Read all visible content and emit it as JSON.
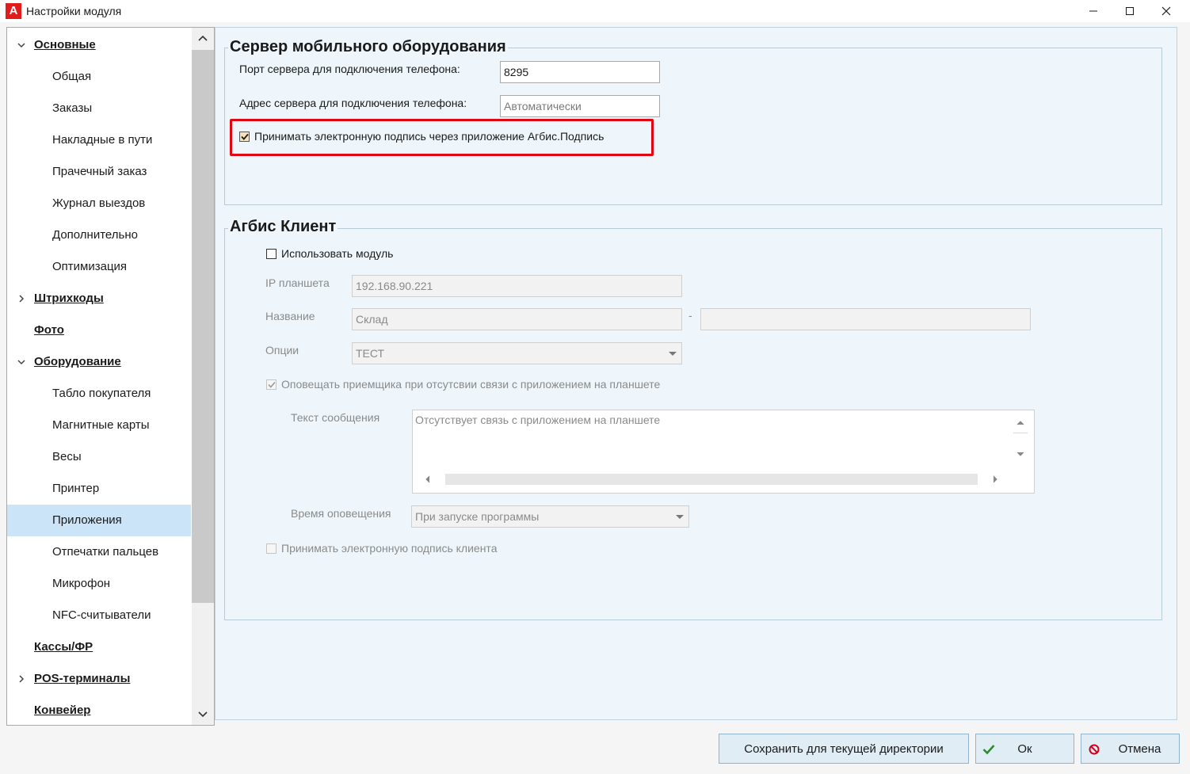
{
  "window": {
    "title": "Настройки модуля",
    "logo_letter": "A"
  },
  "tree": {
    "items": [
      {
        "label": "Основные",
        "level": 0,
        "expander": "expanded"
      },
      {
        "label": "Общая",
        "level": 1
      },
      {
        "label": "Заказы",
        "level": 1
      },
      {
        "label": "Накладные в пути",
        "level": 1
      },
      {
        "label": "Прачечный заказ",
        "level": 1
      },
      {
        "label": "Журнал выездов",
        "level": 1
      },
      {
        "label": "Дополнительно",
        "level": 1
      },
      {
        "label": "Оптимизация",
        "level": 1
      },
      {
        "label": "Штрихкоды",
        "level": 0,
        "expander": "collapsed"
      },
      {
        "label": "Фото",
        "level": 0,
        "expander": "none"
      },
      {
        "label": "Оборудование",
        "level": 0,
        "expander": "expanded"
      },
      {
        "label": "Табло покупателя",
        "level": 1
      },
      {
        "label": "Магнитные карты",
        "level": 1
      },
      {
        "label": "Весы",
        "level": 1
      },
      {
        "label": "Принтер",
        "level": 1
      },
      {
        "label": "Приложения",
        "level": 1,
        "selected": true
      },
      {
        "label": "Отпечатки пальцев",
        "level": 1
      },
      {
        "label": "Микрофон",
        "level": 1
      },
      {
        "label": "NFC-считыватели",
        "level": 1
      },
      {
        "label": "Кассы/ФР",
        "level": 0,
        "expander": "none"
      },
      {
        "label": "POS-терминалы",
        "level": 0,
        "expander": "collapsed"
      },
      {
        "label": "Конвейер",
        "level": 0,
        "expander": "none"
      }
    ]
  },
  "mobile_server": {
    "title": "Сервер мобильного оборудования",
    "port_label": "Порт сервера для подключения телефона:",
    "port_value": "8295",
    "address_label": "Адрес сервера для подключения телефона:",
    "address_placeholder": "Автоматически",
    "accept_signature_label": "Принимать электронную подпись через приложение Агбис.Подпись",
    "accept_signature_checked": true
  },
  "agbis_client": {
    "title": "Агбис Клиент",
    "use_module_label": "Использовать модуль",
    "use_module_checked": false,
    "ip_label": "IP планшета",
    "ip_value": "192.168.90.221",
    "name_label": "Название",
    "name_value": "Склад",
    "name_separator": "-",
    "name_value_2": "",
    "options_label": "Опции",
    "options_value": "ТЕСТ",
    "notify_label": "Оповещать приемщика при отсутсвии связи с приложением на планшете",
    "notify_checked": true,
    "message_label": "Текст сообщения",
    "message_value": "Отсутствует связь с приложением на планшете",
    "notify_time_label": "Время оповещения",
    "notify_time_value": "При запуске программы",
    "accept_client_signature_label": "Принимать электронную подпись клиента",
    "accept_client_signature_checked": false
  },
  "buttons": {
    "save_dir": "Сохранить для текущей директории",
    "ok": "Ок",
    "cancel": "Отмена"
  },
  "colors": {
    "highlight": "#e20613",
    "ok_icon": "#2e8b2e",
    "cancel_icon": "#d0021b",
    "selected_row": "#cce4f7",
    "content_bg": "#eef6fb"
  }
}
